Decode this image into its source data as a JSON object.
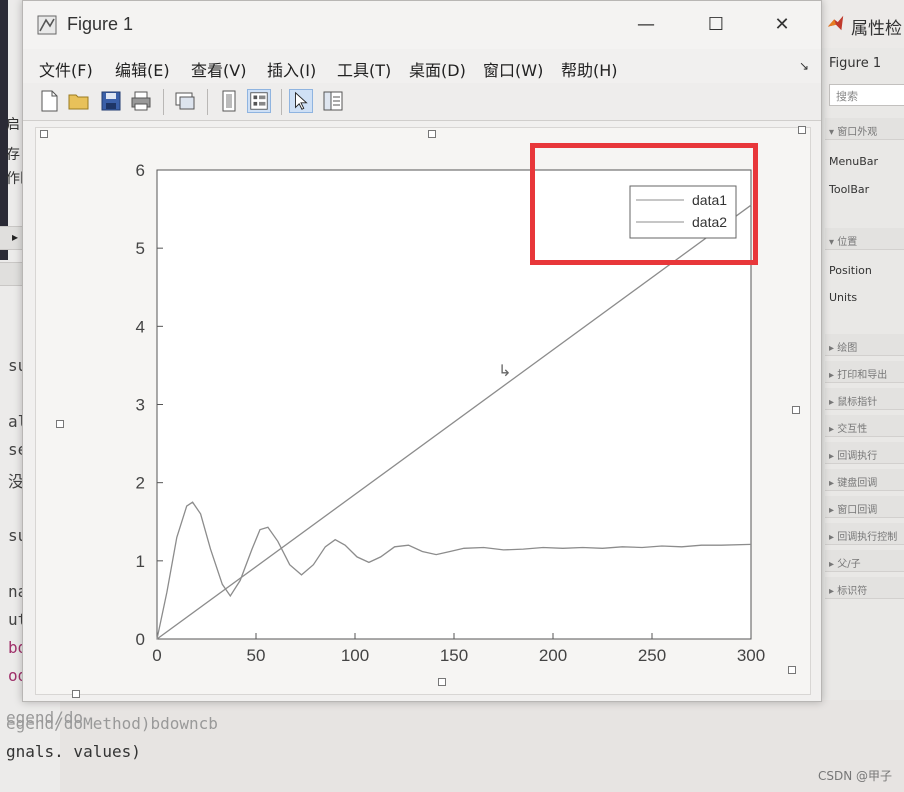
{
  "window": {
    "title": "Figure 1",
    "controls": {
      "minimize": "—",
      "maximize": "☐",
      "close": "✕"
    }
  },
  "menu": [
    "文件(F)",
    "编辑(E)",
    "查看(V)",
    "插入(I)",
    "工具(T)",
    "桌面(D)",
    "窗口(W)",
    "帮助(H)"
  ],
  "toolbar": {
    "icons": [
      "new-figure-icon",
      "open-icon",
      "save-icon",
      "print-icon",
      "link-plot-icon",
      "hide-plot-tools-icon",
      "show-plot-tools-icon",
      "edit-plot-icon",
      "property-editor-icon"
    ]
  },
  "left_editor": {
    "side_labels": [
      "启",
      "存",
      "作区"
    ],
    "lines": [
      "subsr",
      "als. v",
      "set/u",
      "没有信",
      "subsr",
      "nals. v",
      "uttonU",
      "bdemanc",
      "odemanc"
    ]
  },
  "bottom_lines": [
    "egend/do",
    "egend/doMethod)bdowncb",
    "gnals. values)"
  ],
  "inspector": {
    "title": "属性检",
    "object": "Figure 1",
    "search_placeholder": "搜索",
    "groups": [
      "▾ 窗口外观",
      "▾ 位置",
      "▸ 绘图",
      "▸ 打印和导出",
      "▸ 鼠标指针",
      "▸ 交互性",
      "▸ 回调执行",
      "▸ 键盘回调",
      "▸ 窗口回调",
      "▸ 回调执行控制",
      "▸ 父/子",
      "▸ 标识符"
    ],
    "props": [
      "MenuBar",
      "ToolBar",
      "Position",
      "Units"
    ]
  },
  "chart_data": {
    "type": "line",
    "xlim": [
      0,
      300
    ],
    "ylim": [
      0,
      6
    ],
    "xticks": [
      0,
      50,
      100,
      150,
      200,
      250,
      300
    ],
    "yticks": [
      0,
      1,
      2,
      3,
      4,
      5,
      6
    ],
    "grid": false,
    "legend_position": "top-right",
    "series": [
      {
        "name": "data1",
        "color": "#8c8c8c",
        "x": [
          0,
          5,
          10,
          15,
          18,
          22,
          27,
          33,
          37,
          42,
          48,
          52,
          56,
          61,
          67,
          73,
          79,
          85,
          90,
          95,
          101,
          107,
          113,
          120,
          127,
          134,
          141,
          148,
          155,
          165,
          175,
          185,
          195,
          205,
          215,
          225,
          235,
          245,
          255,
          265,
          275,
          285,
          300
        ],
        "y": [
          0,
          0.6,
          1.3,
          1.7,
          1.75,
          1.6,
          1.15,
          0.7,
          0.55,
          0.75,
          1.15,
          1.4,
          1.43,
          1.25,
          0.95,
          0.82,
          0.95,
          1.18,
          1.27,
          1.2,
          1.05,
          0.98,
          1.05,
          1.18,
          1.2,
          1.12,
          1.08,
          1.12,
          1.16,
          1.17,
          1.14,
          1.15,
          1.17,
          1.16,
          1.17,
          1.16,
          1.18,
          1.17,
          1.19,
          1.18,
          1.2,
          1.2,
          1.21
        ]
      },
      {
        "name": "data2",
        "color": "#8c8c8c",
        "x": [
          0,
          300
        ],
        "y": [
          0,
          5.55
        ]
      }
    ]
  },
  "highlight_color": "#e8373a",
  "watermark": "CSDN @甲子"
}
